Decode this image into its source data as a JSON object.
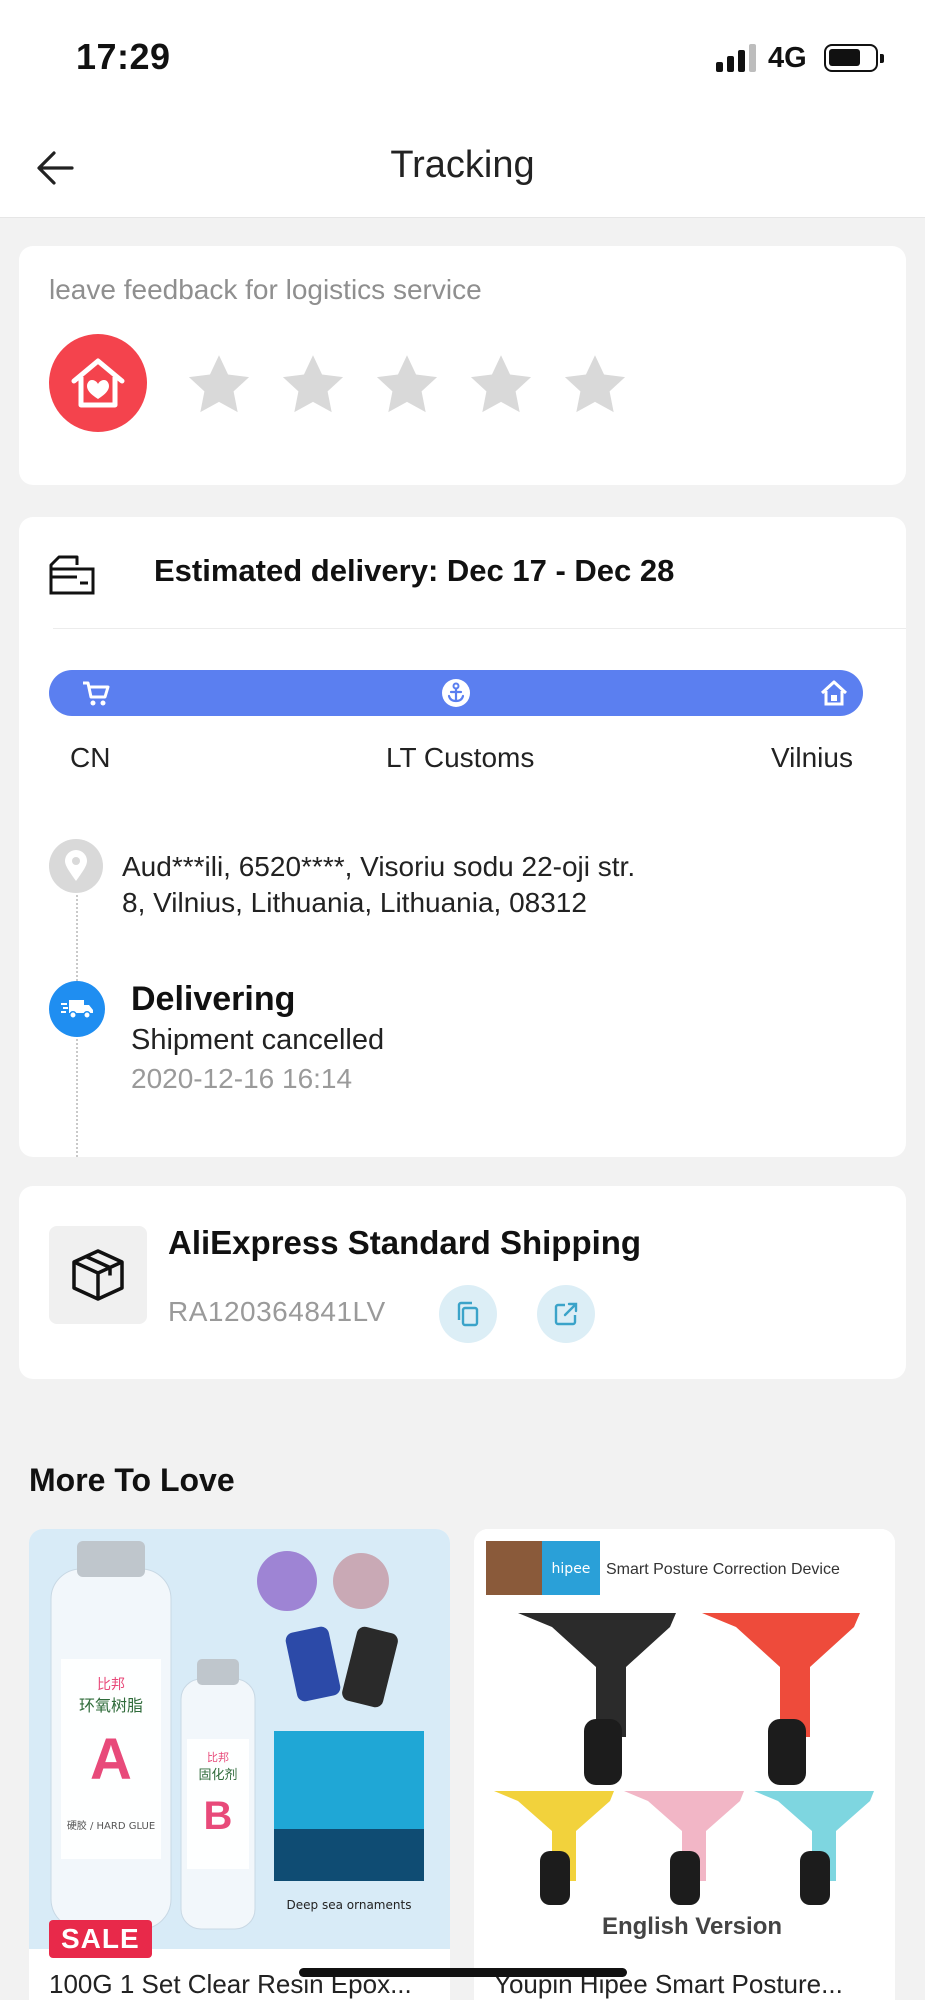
{
  "status_bar": {
    "time": "17:29",
    "network": "4G"
  },
  "header": {
    "title": "Tracking"
  },
  "feedback": {
    "label": "leave feedback for logistics service",
    "stars_total": 5,
    "rating": 0
  },
  "delivery": {
    "estimated": "Estimated delivery: Dec 17 - Dec 28",
    "stages": [
      "CN",
      "LT Customs",
      "Vilnius"
    ],
    "address_line1": "Aud***ili,  6520****,  Visoriu sodu 22-oji str.",
    "address_line2": "8,  Vilnius,  Lithuania,  Lithuania,  08312",
    "status_title": "Delivering",
    "status_detail": "Shipment cancelled",
    "status_time": "2020-12-16 16:14"
  },
  "shipping": {
    "service": "AliExpress Standard Shipping",
    "tracking_number": "RA120364841LV"
  },
  "more_to_love": {
    "title": "More To Love",
    "products": [
      {
        "title": "100G 1 Set Clear Resin Epox...",
        "badge": "SALE",
        "bottle_a_brand": "比邦",
        "bottle_a_label": "环氧树脂",
        "bottle_a_letter": "A",
        "bottle_a_note": "硬胶 / HARD GLUE",
        "bottle_b_brand": "比邦",
        "bottle_b_label": "固化剂",
        "bottle_b_letter": "B",
        "caption": "Deep sea ornaments"
      },
      {
        "title": "Youpin Hipee Smart Posture...",
        "brand": "hipee",
        "headline": "Smart Posture Correction Device",
        "footer": "English Version"
      }
    ]
  },
  "colors": {
    "accent_blue": "#5b7ff0",
    "brand_red": "#f4434d",
    "sale_red": "#e8294a"
  }
}
